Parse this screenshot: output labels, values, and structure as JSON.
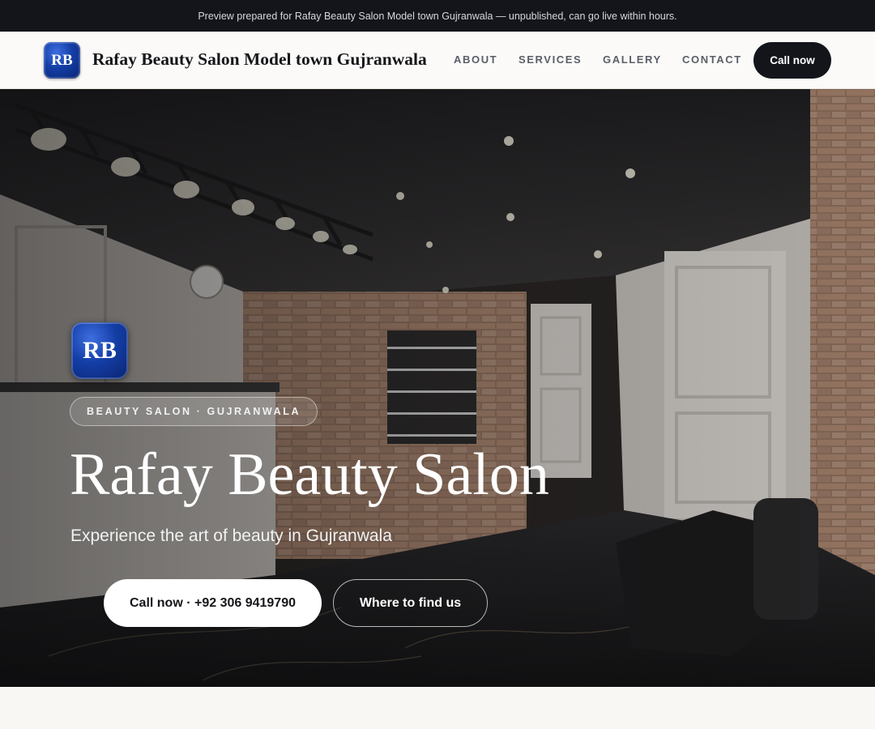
{
  "preview_bar": {
    "text": "Preview prepared for Rafay Beauty Salon Model town Gujranwala — unpublished, can go live within hours."
  },
  "header": {
    "logo_text": "RB",
    "brand_name": "Rafay Beauty Salon Model town Gujranwala",
    "nav": {
      "about": "ABOUT",
      "services": "SERVICES",
      "gallery": "GALLERY",
      "contact": "CONTACT"
    },
    "call_label": "Call now"
  },
  "hero": {
    "logo_text": "RB",
    "badge": "BEAUTY SALON · GUJRANWALA",
    "title": "Rafay Beauty Salon",
    "subtitle": "Experience the art of beauty in Gujranwala",
    "primary_button": "Call now · +92 306 9419790",
    "secondary_button": "Where to find us",
    "background_image": "salon-interior-photo"
  },
  "colors": {
    "dark": "#13151b",
    "page_bg": "#f8f7f4",
    "logo_blue": "#143ea6"
  }
}
